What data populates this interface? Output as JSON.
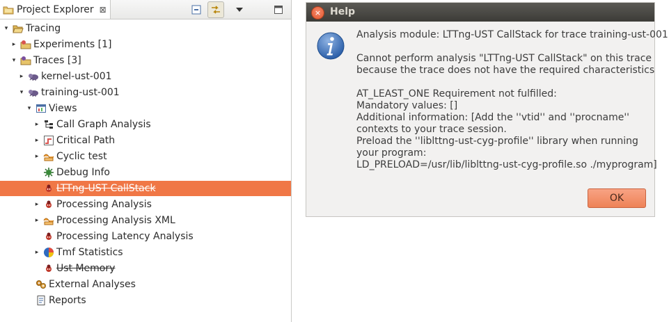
{
  "explorer": {
    "title": "Project Explorer",
    "close_glyph": "⊠",
    "toolbar_icons": [
      "collapse-all-icon",
      "link-with-editor-icon",
      "view-menu-icon",
      "maximize-icon"
    ],
    "tree": [
      {
        "label": "Tracing",
        "icon": "open-folder-icon",
        "arrow": "▾",
        "depth": 0
      },
      {
        "label": "Experiments [1]",
        "icon": "experiments-folder-icon",
        "arrow": "▸",
        "depth": 1
      },
      {
        "label": "Traces [3]",
        "icon": "traces-folder-icon",
        "arrow": "▾",
        "depth": 1
      },
      {
        "label": "kernel-ust-001",
        "icon": "trace-icon",
        "arrow": "▸",
        "depth": 2
      },
      {
        "label": "training-ust-001",
        "icon": "trace-icon",
        "arrow": "▾",
        "depth": 2
      },
      {
        "label": "Views",
        "icon": "views-icon",
        "arrow": "▾",
        "depth": 3
      },
      {
        "label": "Call Graph Analysis",
        "icon": "call-graph-icon",
        "arrow": "▸",
        "depth": 4
      },
      {
        "label": "Critical Path",
        "icon": "critical-path-icon",
        "arrow": "▸",
        "depth": 4
      },
      {
        "label": "Cyclic test",
        "icon": "xml-analysis-icon",
        "arrow": "▸",
        "depth": 4
      },
      {
        "label": "Debug Info",
        "icon": "debug-info-icon",
        "arrow": "",
        "depth": 4
      },
      {
        "label": "LTTng-UST CallStack",
        "icon": "analysis-icon",
        "arrow": "",
        "depth": 4,
        "selected": true,
        "strike": true
      },
      {
        "label": "Processing Analysis",
        "icon": "analysis-icon",
        "arrow": "▸",
        "depth": 4
      },
      {
        "label": "Processing Analysis XML",
        "icon": "xml-analysis-icon",
        "arrow": "▸",
        "depth": 4
      },
      {
        "label": "Processing Latency Analysis",
        "icon": "analysis-icon",
        "arrow": "",
        "depth": 4
      },
      {
        "label": "Tmf Statistics",
        "icon": "statistics-pie-icon",
        "arrow": "▸",
        "depth": 4
      },
      {
        "label": "Ust Memory",
        "icon": "analysis-icon",
        "arrow": "",
        "depth": 4,
        "strike": true
      },
      {
        "label": "External Analyses",
        "icon": "external-analyses-icon",
        "arrow": "",
        "depth": 3
      },
      {
        "label": "Reports",
        "icon": "reports-icon",
        "arrow": "",
        "depth": 3
      }
    ]
  },
  "dialog": {
    "title": "Help",
    "close_glyph": "×",
    "lines": [
      "Analysis module: LTTng-UST CallStack for trace training-ust-001",
      "",
      "Cannot perform analysis \"LTTng-UST CallStack\" on this trace",
      "because the trace does not have the required characteristics",
      "",
      "AT_LEAST_ONE Requirement not fulfilled:",
      "Mandatory values: []",
      "Additional information: [Add the ''vtid'' and ''procname''",
      "contexts to your trace session.",
      "Preload the ''liblttng-ust-cyg-profile'' library when running",
      "your program:",
      "LD_PRELOAD=/usr/lib/liblttng-ust-cyg-profile.so ./myprogram]"
    ],
    "ok_label": "OK",
    "accent_color": "#f07746"
  }
}
